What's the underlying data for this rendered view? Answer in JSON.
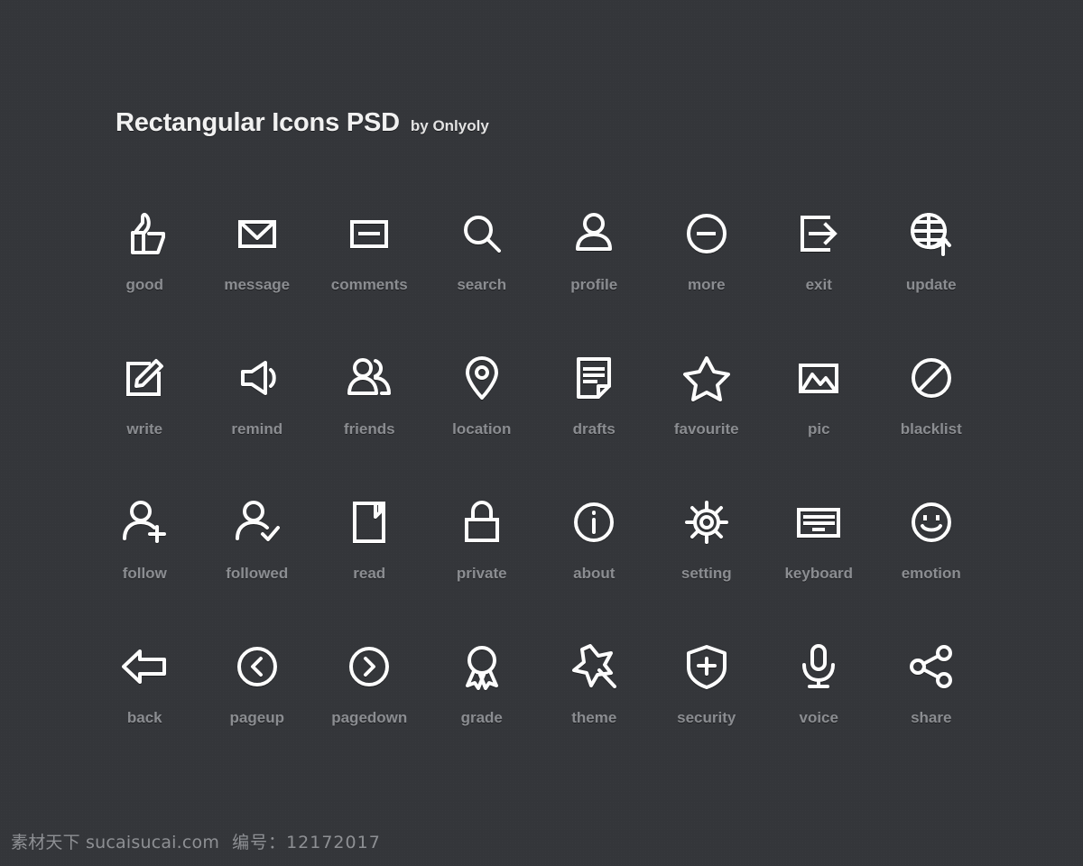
{
  "header": {
    "title": "Rectangular Icons PSD",
    "byline": "by Onlyoly"
  },
  "colors": {
    "background": "#34363a",
    "icon_stroke": "#fdfdfd",
    "label": "#8b8d91",
    "title": "#f2f2f2",
    "watermark": "#8e9094"
  },
  "grid": {
    "columns": 8,
    "rows": 4,
    "icons": [
      {
        "icon": "thumbs-up-icon",
        "label": "good"
      },
      {
        "icon": "envelope-icon",
        "label": "message"
      },
      {
        "icon": "comment-box-icon",
        "label": "comments"
      },
      {
        "icon": "magnifier-icon",
        "label": "search"
      },
      {
        "icon": "person-icon",
        "label": "profile"
      },
      {
        "icon": "circle-ellipsis-icon",
        "label": "more"
      },
      {
        "icon": "exit-arrow-icon",
        "label": "exit"
      },
      {
        "icon": "globe-up-arrow-icon",
        "label": "update"
      },
      {
        "icon": "pencil-square-icon",
        "label": "write"
      },
      {
        "icon": "speaker-icon",
        "label": "remind"
      },
      {
        "icon": "two-people-icon",
        "label": "friends"
      },
      {
        "icon": "map-pin-icon",
        "label": "location"
      },
      {
        "icon": "document-icon",
        "label": "drafts"
      },
      {
        "icon": "star-icon",
        "label": "favourite"
      },
      {
        "icon": "photo-icon",
        "label": "pic"
      },
      {
        "icon": "no-entry-icon",
        "label": "blacklist"
      },
      {
        "icon": "person-plus-icon",
        "label": "follow"
      },
      {
        "icon": "person-check-icon",
        "label": "followed"
      },
      {
        "icon": "book-icon",
        "label": "read"
      },
      {
        "icon": "lock-icon",
        "label": "private"
      },
      {
        "icon": "info-circle-icon",
        "label": "about"
      },
      {
        "icon": "gear-icon",
        "label": "setting"
      },
      {
        "icon": "keyboard-icon",
        "label": "keyboard"
      },
      {
        "icon": "smiley-icon",
        "label": "emotion"
      },
      {
        "icon": "back-arrow-icon",
        "label": "back"
      },
      {
        "icon": "chevron-left-circle-icon",
        "label": "pageup"
      },
      {
        "icon": "chevron-right-circle-icon",
        "label": "pagedown"
      },
      {
        "icon": "medal-icon",
        "label": "grade"
      },
      {
        "icon": "magic-wand-icon",
        "label": "theme"
      },
      {
        "icon": "shield-plus-icon",
        "label": "security"
      },
      {
        "icon": "microphone-icon",
        "label": "voice"
      },
      {
        "icon": "share-nodes-icon",
        "label": "share"
      }
    ]
  },
  "watermark": {
    "site": "素材天下 sucaisucai.com",
    "number": "编号：12172017"
  }
}
